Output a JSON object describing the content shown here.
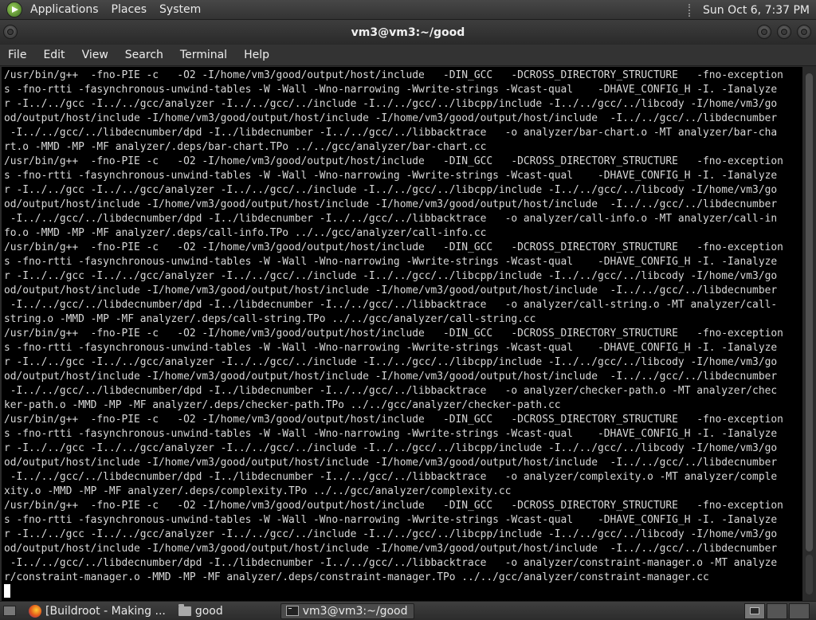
{
  "top_panel": {
    "menus": [
      "Applications",
      "Places",
      "System"
    ],
    "clock": "Sun Oct  6,  7:37 PM"
  },
  "window": {
    "title": "vm3@vm3:~/good"
  },
  "menubar": {
    "items": [
      "File",
      "Edit",
      "View",
      "Search",
      "Terminal",
      "Help"
    ]
  },
  "terminal": {
    "lines": [
      "/usr/bin/g++  -fno-PIE -c   -O2 -I/home/vm3/good/output/host/include   -DIN_GCC   -DCROSS_DIRECTORY_STRUCTURE   -fno-exception",
      "s -fno-rtti -fasynchronous-unwind-tables -W -Wall -Wno-narrowing -Wwrite-strings -Wcast-qual    -DHAVE_CONFIG_H -I. -Ianalyze",
      "r -I../../gcc -I../../gcc/analyzer -I../../gcc/../include -I../../gcc/../libcpp/include -I../../gcc/../libcody -I/home/vm3/go",
      "od/output/host/include -I/home/vm3/good/output/host/include -I/home/vm3/good/output/host/include  -I../../gcc/../libdecnumber",
      " -I../../gcc/../libdecnumber/dpd -I../libdecnumber -I../../gcc/../libbacktrace   -o analyzer/bar-chart.o -MT analyzer/bar-cha",
      "rt.o -MMD -MP -MF analyzer/.deps/bar-chart.TPo ../../gcc/analyzer/bar-chart.cc",
      "/usr/bin/g++  -fno-PIE -c   -O2 -I/home/vm3/good/output/host/include   -DIN_GCC   -DCROSS_DIRECTORY_STRUCTURE   -fno-exception",
      "s -fno-rtti -fasynchronous-unwind-tables -W -Wall -Wno-narrowing -Wwrite-strings -Wcast-qual    -DHAVE_CONFIG_H -I. -Ianalyze",
      "r -I../../gcc -I../../gcc/analyzer -I../../gcc/../include -I../../gcc/../libcpp/include -I../../gcc/../libcody -I/home/vm3/go",
      "od/output/host/include -I/home/vm3/good/output/host/include -I/home/vm3/good/output/host/include  -I../../gcc/../libdecnumber",
      " -I../../gcc/../libdecnumber/dpd -I../libdecnumber -I../../gcc/../libbacktrace   -o analyzer/call-info.o -MT analyzer/call-in",
      "fo.o -MMD -MP -MF analyzer/.deps/call-info.TPo ../../gcc/analyzer/call-info.cc",
      "/usr/bin/g++  -fno-PIE -c   -O2 -I/home/vm3/good/output/host/include   -DIN_GCC   -DCROSS_DIRECTORY_STRUCTURE   -fno-exception",
      "s -fno-rtti -fasynchronous-unwind-tables -W -Wall -Wno-narrowing -Wwrite-strings -Wcast-qual    -DHAVE_CONFIG_H -I. -Ianalyze",
      "r -I../../gcc -I../../gcc/analyzer -I../../gcc/../include -I../../gcc/../libcpp/include -I../../gcc/../libcody -I/home/vm3/go",
      "od/output/host/include -I/home/vm3/good/output/host/include -I/home/vm3/good/output/host/include  -I../../gcc/../libdecnumber",
      " -I../../gcc/../libdecnumber/dpd -I../libdecnumber -I../../gcc/../libbacktrace   -o analyzer/call-string.o -MT analyzer/call-",
      "string.o -MMD -MP -MF analyzer/.deps/call-string.TPo ../../gcc/analyzer/call-string.cc",
      "/usr/bin/g++  -fno-PIE -c   -O2 -I/home/vm3/good/output/host/include   -DIN_GCC   -DCROSS_DIRECTORY_STRUCTURE   -fno-exception",
      "s -fno-rtti -fasynchronous-unwind-tables -W -Wall -Wno-narrowing -Wwrite-strings -Wcast-qual    -DHAVE_CONFIG_H -I. -Ianalyze",
      "r -I../../gcc -I../../gcc/analyzer -I../../gcc/../include -I../../gcc/../libcpp/include -I../../gcc/../libcody -I/home/vm3/go",
      "od/output/host/include -I/home/vm3/good/output/host/include -I/home/vm3/good/output/host/include  -I../../gcc/../libdecnumber",
      " -I../../gcc/../libdecnumber/dpd -I../libdecnumber -I../../gcc/../libbacktrace   -o analyzer/checker-path.o -MT analyzer/chec",
      "ker-path.o -MMD -MP -MF analyzer/.deps/checker-path.TPo ../../gcc/analyzer/checker-path.cc",
      "/usr/bin/g++  -fno-PIE -c   -O2 -I/home/vm3/good/output/host/include   -DIN_GCC   -DCROSS_DIRECTORY_STRUCTURE   -fno-exception",
      "s -fno-rtti -fasynchronous-unwind-tables -W -Wall -Wno-narrowing -Wwrite-strings -Wcast-qual    -DHAVE_CONFIG_H -I. -Ianalyze",
      "r -I../../gcc -I../../gcc/analyzer -I../../gcc/../include -I../../gcc/../libcpp/include -I../../gcc/../libcody -I/home/vm3/go",
      "od/output/host/include -I/home/vm3/good/output/host/include -I/home/vm3/good/output/host/include  -I../../gcc/../libdecnumber",
      " -I../../gcc/../libdecnumber/dpd -I../libdecnumber -I../../gcc/../libbacktrace   -o analyzer/complexity.o -MT analyzer/comple",
      "xity.o -MMD -MP -MF analyzer/.deps/complexity.TPo ../../gcc/analyzer/complexity.cc",
      "/usr/bin/g++  -fno-PIE -c   -O2 -I/home/vm3/good/output/host/include   -DIN_GCC   -DCROSS_DIRECTORY_STRUCTURE   -fno-exception",
      "s -fno-rtti -fasynchronous-unwind-tables -W -Wall -Wno-narrowing -Wwrite-strings -Wcast-qual    -DHAVE_CONFIG_H -I. -Ianalyze",
      "r -I../../gcc -I../../gcc/analyzer -I../../gcc/../include -I../../gcc/../libcpp/include -I../../gcc/../libcody -I/home/vm3/go",
      "od/output/host/include -I/home/vm3/good/output/host/include -I/home/vm3/good/output/host/include  -I../../gcc/../libdecnumber",
      " -I../../gcc/../libdecnumber/dpd -I../libdecnumber -I../../gcc/../libbacktrace   -o analyzer/constraint-manager.o -MT analyze",
      "r/constraint-manager.o -MMD -MP -MF analyzer/.deps/constraint-manager.TPo ../../gcc/analyzer/constraint-manager.cc"
    ]
  },
  "taskbar": {
    "tasks": [
      {
        "label": "[Buildroot - Making ...",
        "icon": "firefox-icon"
      },
      {
        "label": "good",
        "icon": "folder-icon"
      },
      {
        "label": "vm3@vm3:~/good",
        "icon": "terminal-icon"
      }
    ]
  }
}
